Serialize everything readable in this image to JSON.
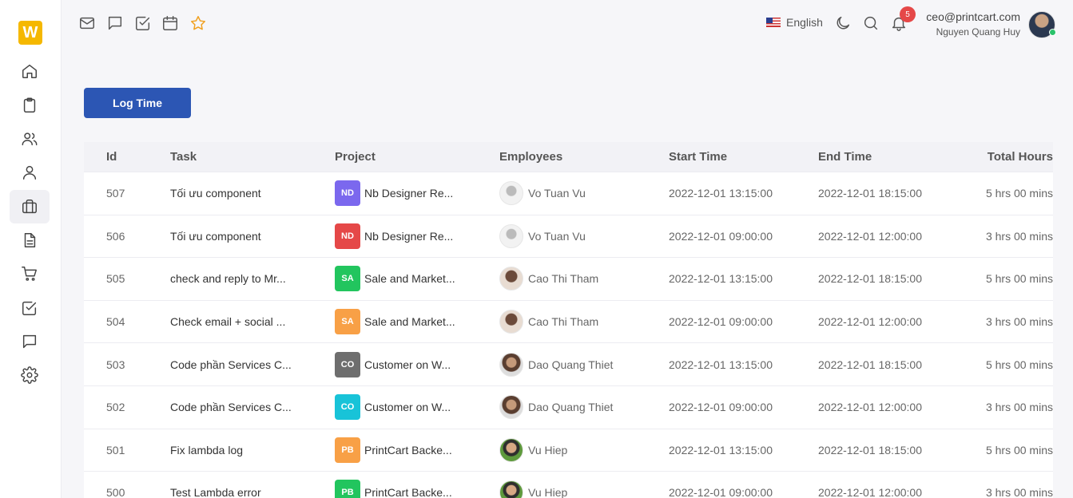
{
  "app": {
    "logo_letter": "W",
    "brand_color": "#f5b800"
  },
  "sidebar": {
    "items": [
      {
        "icon": "home-icon"
      },
      {
        "icon": "clipboard-icon"
      },
      {
        "icon": "users-icon"
      },
      {
        "icon": "user-icon"
      },
      {
        "icon": "briefcase-icon",
        "active": true
      },
      {
        "icon": "document-icon"
      },
      {
        "icon": "cart-icon"
      },
      {
        "icon": "checkbox-icon"
      },
      {
        "icon": "chat-icon"
      },
      {
        "icon": "gear-icon"
      }
    ]
  },
  "header": {
    "shortcuts": [
      "mail-icon",
      "chat-icon",
      "checkbox-icon",
      "calendar-icon",
      "star-icon"
    ],
    "language": "English",
    "notifications_count": "5",
    "user_email": "ceo@printcart.com",
    "user_name": "Nguyen Quang Huy"
  },
  "actions": {
    "log_time_label": "Log Time",
    "button_color": "#2c56b4"
  },
  "table": {
    "columns": {
      "id": "Id",
      "task": "Task",
      "project": "Project",
      "employees": "Employees",
      "start": "Start Time",
      "end": "End Time",
      "total": "Total Hours"
    },
    "rows": [
      {
        "id": "507",
        "task": "Tối ưu component",
        "proj_abbr": "ND",
        "proj_color": "#7b68ee",
        "project": "Nb Designer Re...",
        "employee": "Vo Tuan Vu",
        "start": "2022-12-01 13:15:00",
        "end": "2022-12-01 18:15:00",
        "total": "5 hrs 00 mins"
      },
      {
        "id": "506",
        "task": "Tối ưu component",
        "proj_abbr": "ND",
        "proj_color": "#e54848",
        "project": "Nb Designer Re...",
        "employee": "Vo Tuan Vu",
        "start": "2022-12-01 09:00:00",
        "end": "2022-12-01 12:00:00",
        "total": "3 hrs 00 mins"
      },
      {
        "id": "505",
        "task": "check and reply to Mr...",
        "proj_abbr": "SA",
        "proj_color": "#22c55e",
        "project": "Sale and Market...",
        "employee": "Cao Thi Tham",
        "start": "2022-12-01 13:15:00",
        "end": "2022-12-01 18:15:00",
        "total": "5 hrs 00 mins"
      },
      {
        "id": "504",
        "task": "Check email + social ...",
        "proj_abbr": "SA",
        "proj_color": "#f8a046",
        "project": "Sale and Market...",
        "employee": "Cao Thi Tham",
        "start": "2022-12-01 09:00:00",
        "end": "2022-12-01 12:00:00",
        "total": "3 hrs 00 mins"
      },
      {
        "id": "503",
        "task": "Code phần Services C...",
        "proj_abbr": "CO",
        "proj_color": "#6e6e6e",
        "project": "Customer on W...",
        "employee": "Dao Quang Thiet",
        "start": "2022-12-01 13:15:00",
        "end": "2022-12-01 18:15:00",
        "total": "5 hrs 00 mins"
      },
      {
        "id": "502",
        "task": "Code phần Services C...",
        "proj_abbr": "CO",
        "proj_color": "#18c3d8",
        "project": "Customer on W...",
        "employee": "Dao Quang Thiet",
        "start": "2022-12-01 09:00:00",
        "end": "2022-12-01 12:00:00",
        "total": "3 hrs 00 mins"
      },
      {
        "id": "501",
        "task": "Fix lambda log",
        "proj_abbr": "PB",
        "proj_color": "#f8a046",
        "project": "PrintCart Backe...",
        "employee": "Vu Hiep",
        "start": "2022-12-01 13:15:00",
        "end": "2022-12-01 18:15:00",
        "total": "5 hrs 00 mins"
      },
      {
        "id": "500",
        "task": "Test Lambda error",
        "proj_abbr": "PB",
        "proj_color": "#22c55e",
        "project": "PrintCart Backe...",
        "employee": "Vu Hiep",
        "start": "2022-12-01 09:00:00",
        "end": "2022-12-01 12:00:00",
        "total": "3 hrs 00 mins"
      }
    ]
  }
}
